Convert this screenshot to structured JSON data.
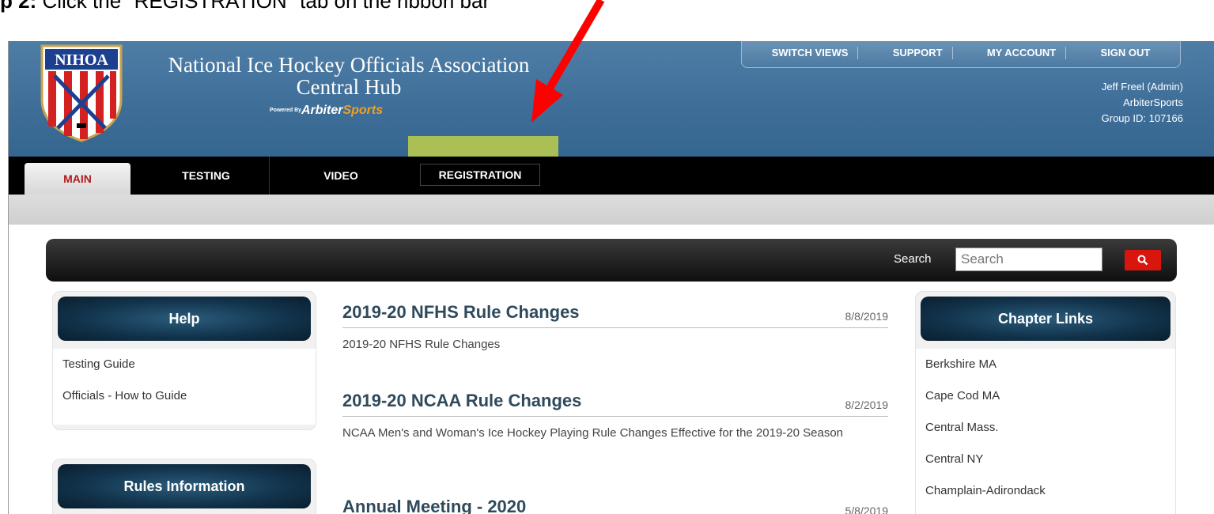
{
  "instruction": {
    "step": "p 2:",
    "text": " Click the \"REGISTRATION\" tab on the ribbon bar"
  },
  "header": {
    "logo_text": "NIHOA",
    "title_line1": "National Ice Hockey Officials Association",
    "title_line2": "Central Hub",
    "powered_by": "Powered By",
    "brand_part1": "Arbiter",
    "brand_part2": "Sports"
  },
  "top_nav": {
    "items": [
      "SWITCH VIEWS",
      "SUPPORT",
      "MY ACCOUNT",
      "SIGN OUT"
    ]
  },
  "user": {
    "name": "Jeff Freel (Admin)",
    "org": "ArbiterSports",
    "group": "Group ID: 107166"
  },
  "ribbon": {
    "tabs": [
      "MAIN",
      "TESTING",
      "VIDEO",
      "REGISTRATION"
    ]
  },
  "search": {
    "label": "Search",
    "placeholder": "Search"
  },
  "help_panel": {
    "title": "Help",
    "links": [
      "Testing Guide",
      "Officials - How to Guide"
    ]
  },
  "rules_panel": {
    "title": "Rules Information"
  },
  "news": [
    {
      "title": "2019-20 NFHS Rule Changes",
      "date": "8/8/2019",
      "desc": "2019-20 NFHS Rule Changes"
    },
    {
      "title": "2019-20 NCAA Rule Changes",
      "date": "8/2/2019",
      "desc": "NCAA Men's and Woman's Ice Hockey Playing Rule Changes Effective for the 2019-20 Season"
    },
    {
      "title": "Annual Meeting - 2020",
      "date": "5/8/2019",
      "desc": ""
    }
  ],
  "chapter_panel": {
    "title": "Chapter Links",
    "links": [
      "Berkshire MA",
      "Cape Cod MA",
      "Central Mass.",
      "Central NY",
      "Champlain-Adirondack"
    ]
  },
  "colors": {
    "header_blue": "#3f6f99",
    "highlight": "#dce63c",
    "arrow": "#ff0000",
    "search_button": "#d8160e",
    "main_tab_text": "#b01c1c"
  }
}
